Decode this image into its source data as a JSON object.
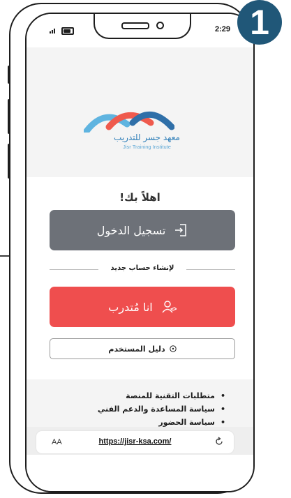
{
  "step": {
    "number": "1",
    "color": "#205778"
  },
  "status_bar": {
    "time": "2:29"
  },
  "logo": {
    "arabic_name": "معهد جسر للتدريب",
    "english_name": "Jisr Training Institute",
    "colors": [
      "#2f7fb9",
      "#ef5a4d",
      "#5fb4e0"
    ]
  },
  "login": {
    "welcome": "اهلاً بك!",
    "login_button": "تسجيل الدخول",
    "create_account": "لإنشاء حساب جديد",
    "trainee_button": "انا مُتدرب",
    "user_guide": "دليل المستخدم",
    "login_color": "#6d7178",
    "trainee_color": "#ef4e4e"
  },
  "links": [
    "متطلبات التقنية للمنصة",
    "سياسة المساعدة والدعم الفني",
    "سياسة الحضور"
  ],
  "browser": {
    "text_size": "AA",
    "url": "https://jisr-ksa.com/"
  }
}
